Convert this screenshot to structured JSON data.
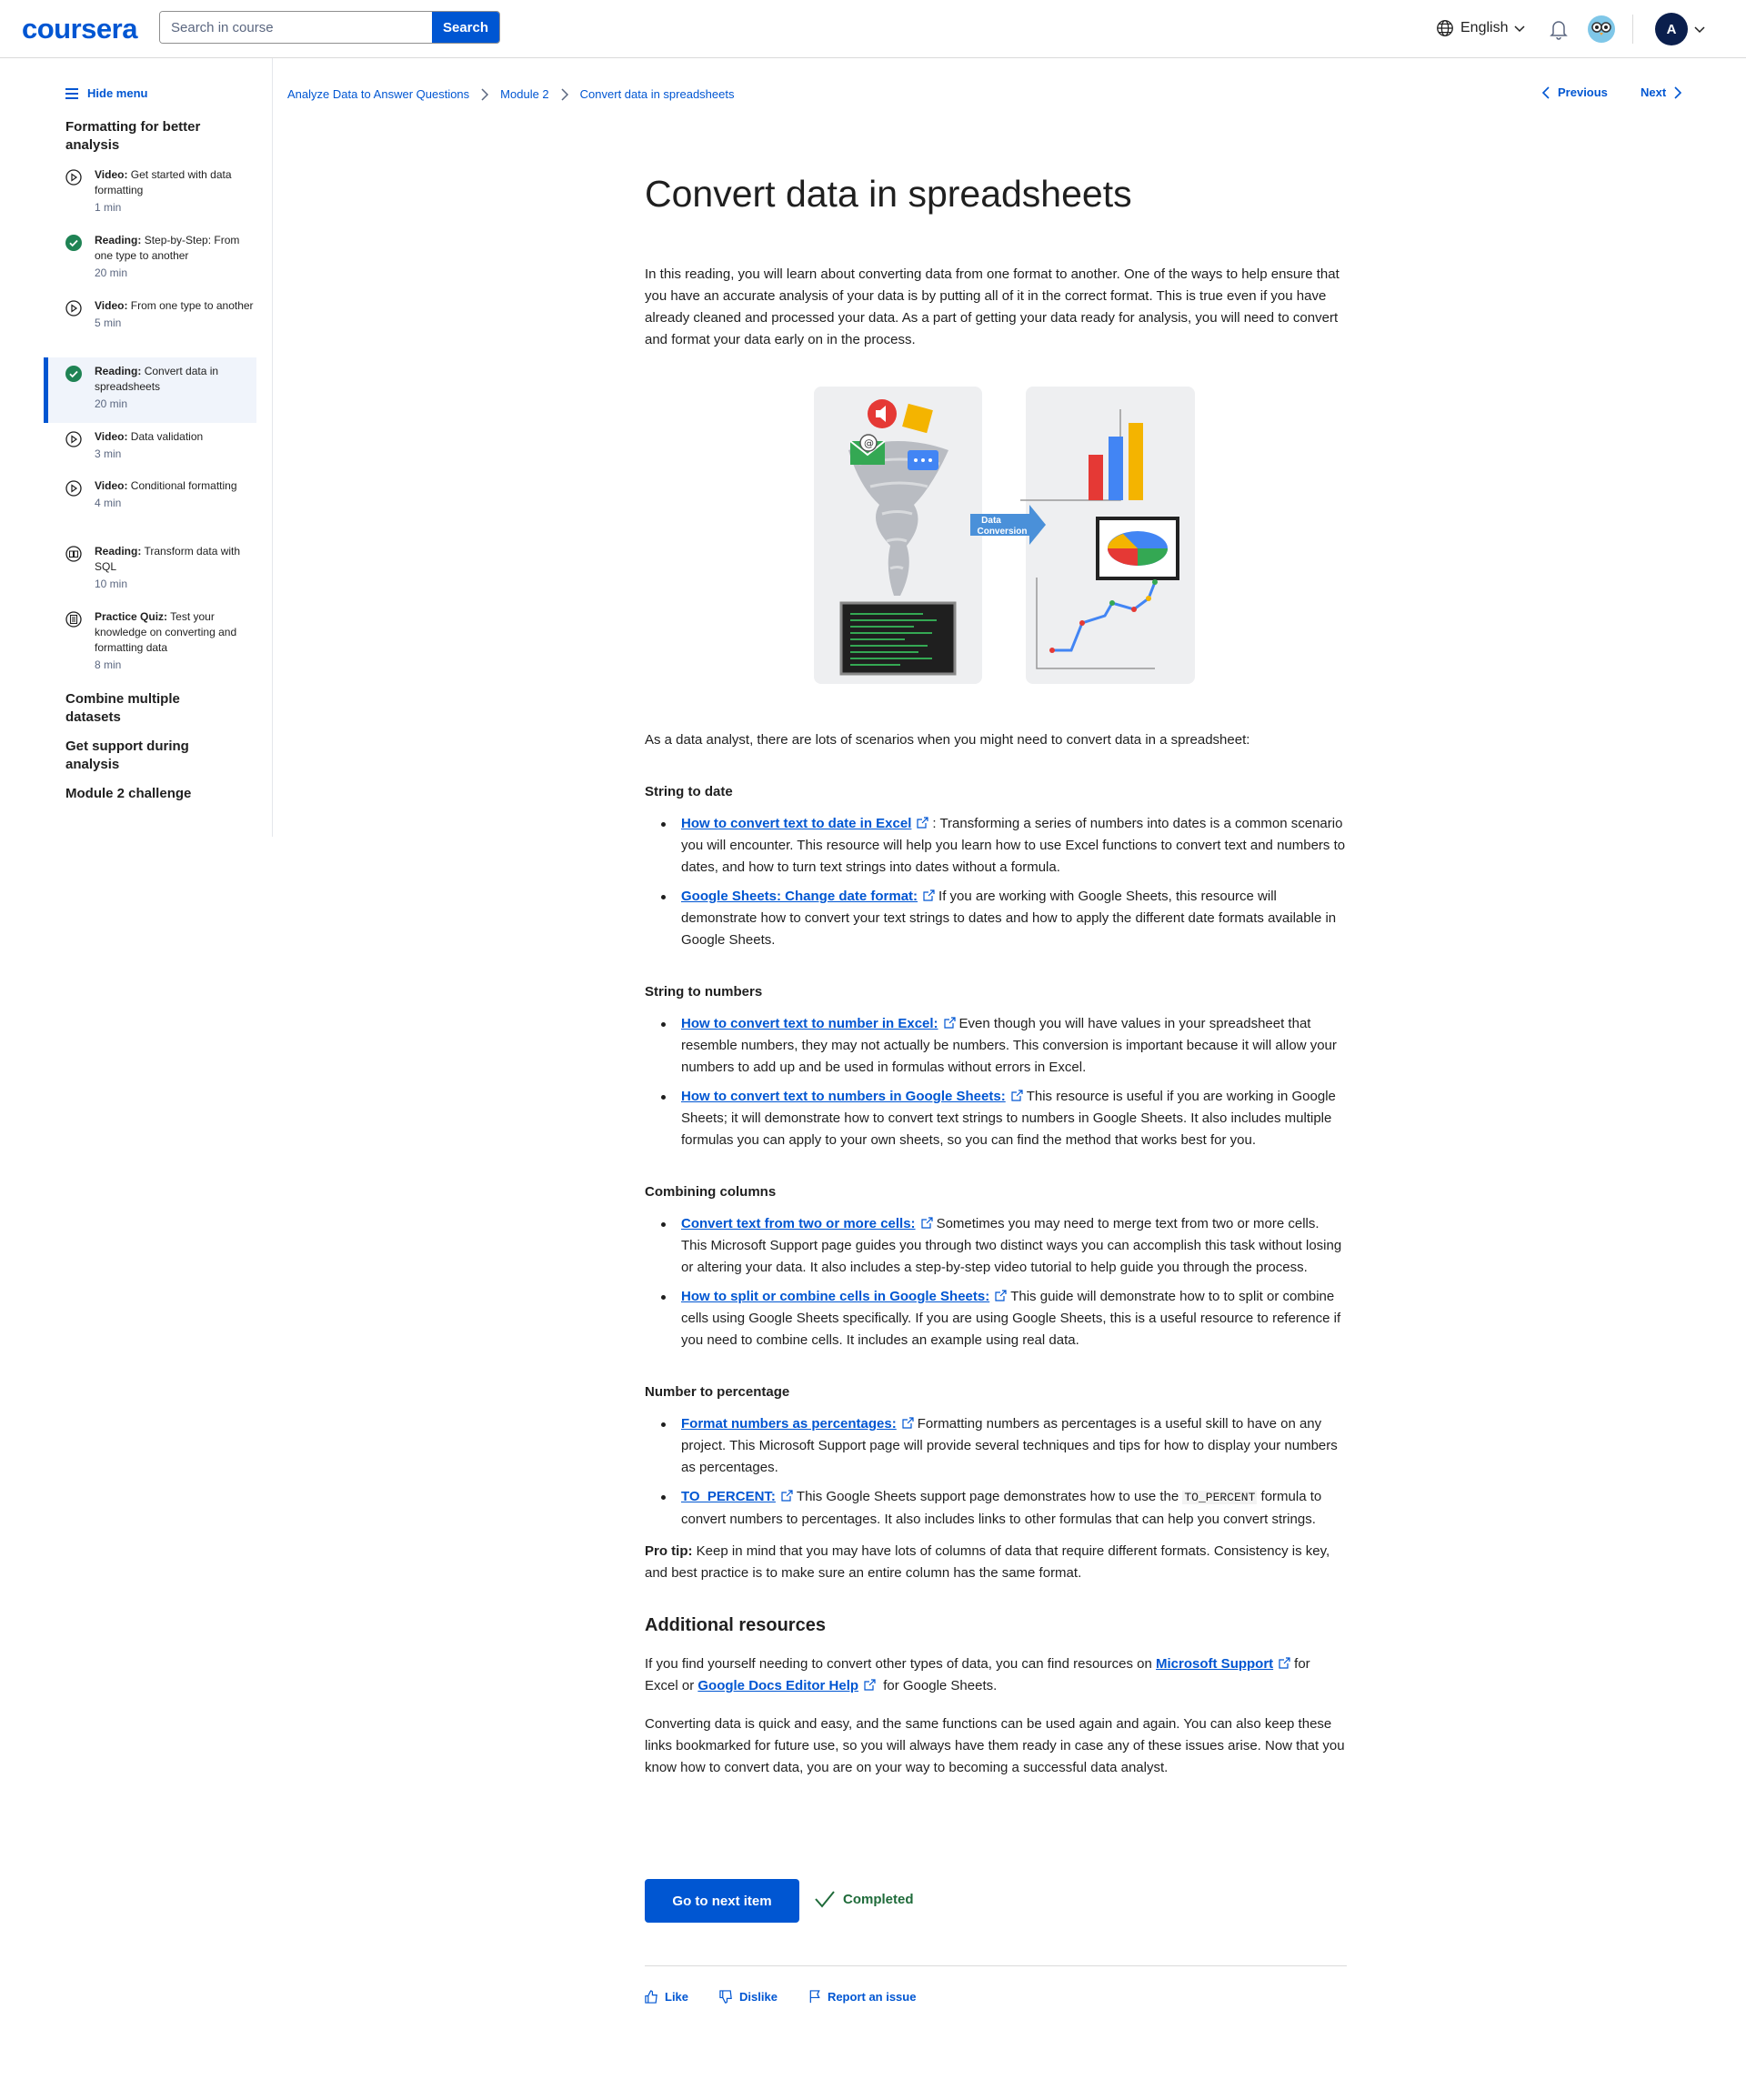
{
  "header": {
    "logo": "coursera",
    "search_placeholder": "Search in course",
    "search_button": "Search",
    "language": "English",
    "avatar_initial": "A"
  },
  "sidebar": {
    "hide_menu": "Hide menu",
    "module_title": "Formatting for better analysis",
    "items": [
      {
        "type": "Video:",
        "title": "Get started with data formatting",
        "duration": "1 min",
        "icon": "play-icon"
      },
      {
        "type": "Reading:",
        "title": "Step-by-Step: From one type to another",
        "duration": "20 min",
        "icon": "check-circle-icon"
      },
      {
        "type": "Video:",
        "title": "From one type to another",
        "duration": "5 min",
        "icon": "play-icon"
      },
      {
        "type": "Reading:",
        "title": "Convert data in spreadsheets",
        "duration": "20 min",
        "icon": "check-circle-icon"
      },
      {
        "type": "Video:",
        "title": "Data validation",
        "duration": "3 min",
        "icon": "play-icon"
      },
      {
        "type": "Video:",
        "title": "Conditional formatting",
        "duration": "4 min",
        "icon": "play-icon"
      },
      {
        "type": "Reading:",
        "title": "Transform data with SQL",
        "duration": "10 min",
        "icon": "reading-icon"
      },
      {
        "type": "Practice Quiz:",
        "title": "Test your knowledge on converting and formatting data",
        "duration": "8 min",
        "icon": "quiz-icon"
      }
    ],
    "other_modules": [
      "Combine multiple datasets",
      "Get support during analysis",
      "Module 2 challenge"
    ]
  },
  "breadcrumb": [
    "Analyze Data to Answer Questions",
    "Module 2",
    "Convert data in spreadsheets"
  ],
  "nav": {
    "previous": "Previous",
    "next": "Next"
  },
  "content": {
    "title": "Convert data in spreadsheets",
    "intro": "In this reading, you will learn about converting data from one format to another. One of the ways to help ensure that you have an accurate analysis of your data is by putting all of it in the correct format. This is true even if you have already cleaned and processed your data. As a part of getting your data ready for analysis, you will need to convert and format your data early on in the process.",
    "illustration_label": "Data Conversion",
    "lead": "As a data analyst, there are lots of scenarios when you might need to convert data in a spreadsheet:",
    "sections": [
      {
        "heading": "String to date",
        "items": [
          {
            "link": "How to convert text to date in Excel",
            "text": ": Transforming a series of numbers into dates is a common scenario you will encounter. This resource will help you learn how to use Excel functions to convert text and numbers to dates, and how to turn text strings into dates without a formula."
          },
          {
            "link": "Google Sheets: Change date format:",
            "text": "If you are working with Google Sheets, this resource will demonstrate how to convert your text strings to dates and how to apply the different date formats available in Google Sheets."
          }
        ]
      },
      {
        "heading": "String to numbers",
        "items": [
          {
            "link": "How to convert text to number in Excel:",
            "text": "Even though you will have values in your spreadsheet that resemble numbers, they may not actually be numbers. This conversion is important because it will allow your numbers to add up and be used in formulas without errors in Excel."
          },
          {
            "link": "How to convert text to numbers in Google Sheets:",
            "text": "This resource is useful if you are working in Google Sheets; it will demonstrate how to convert text strings to numbers in Google Sheets. It also includes multiple formulas you can apply to your own sheets, so you can find the method that works best for you."
          }
        ]
      },
      {
        "heading": "Combining columns",
        "items": [
          {
            "link": "Convert text from two or more cells:",
            "text": "Sometimes you may need to merge text from two or more cells. This Microsoft Support page guides you through two distinct ways you can accomplish this task without losing or altering your data. It also includes a step-by-step video tutorial to help guide you through the process."
          },
          {
            "link": "How to split or combine cells in Google Sheets:",
            "text": "This guide will demonstrate how to to split or combine cells using Google Sheets specifically. If you are using Google Sheets, this is a useful resource to reference if you need to combine cells. It includes an example using real data."
          }
        ]
      },
      {
        "heading": "Number to percentage",
        "items": [
          {
            "link": "Format numbers as percentages:",
            "text": "Formatting numbers as percentages is a useful skill to have on any project. This Microsoft Support page will provide several techniques and tips for how to display your numbers as percentages."
          },
          {
            "link": "TO_PERCENT:",
            "text_before": "This Google Sheets support page demonstrates how to use the ",
            "code": "TO_PERCENT",
            "text_after": " formula to convert numbers to percentages. It also includes links to other formulas that can help you convert strings."
          }
        ]
      }
    ],
    "pro_tip_label": "Pro tip:",
    "pro_tip": "Keep in mind that you may have lots of columns of data that require different formats. Consistency is key, and best practice is to make sure an entire column has the same format.",
    "additional_heading": "Additional resources",
    "additional_p1_a": "If you find yourself needing to convert other types of data, you can find resources on ",
    "additional_link1": "Microsoft Support",
    "additional_p1_b": "for Excel or ",
    "additional_link2": "Google Docs Editor Help",
    "additional_p1_c": " for Google Sheets.",
    "closing": "Converting data is quick and easy, and the same functions can be used again and again. You can also keep these links bookmarked for future use, so you will always have them ready in case any of these issues arise. Now that you know how to convert data, you are on your way to becoming a successful data analyst."
  },
  "footer": {
    "next_button": "Go to next item",
    "completed": "Completed",
    "like": "Like",
    "dislike": "Dislike",
    "report": "Report an issue"
  },
  "colors": {
    "brand": "#0056d2",
    "success": "#1f6b3a",
    "active_bg": "#f0f4fb"
  }
}
